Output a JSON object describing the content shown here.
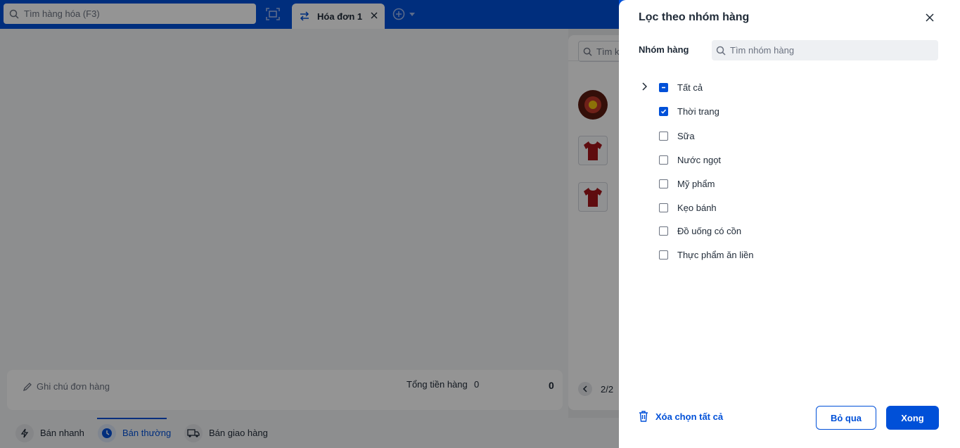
{
  "top": {
    "search_placeholder": "Tìm hàng hóa (F3)",
    "active_tab_label": "Hóa đơn 1"
  },
  "products_panel": {
    "search_placeholder": "Tìm k",
    "pager": "2/2"
  },
  "order_footer": {
    "note_placeholder": "Ghi chú đơn hàng",
    "total_label": "Tổng tiền hàng",
    "total_count": "0",
    "total_amount": "0"
  },
  "bottom_nav": {
    "items": [
      {
        "label": "Bán nhanh",
        "icon": "lightning-icon"
      },
      {
        "label": "Bán thường",
        "icon": "clock-icon",
        "active": true
      },
      {
        "label": "Bán giao hàng",
        "icon": "truck-icon"
      }
    ]
  },
  "filter_drawer": {
    "title": "Lọc theo nhóm hàng",
    "group_label": "Nhóm hàng",
    "group_search_placeholder": "Tìm nhóm hàng",
    "categories": [
      {
        "label": "Tất cả",
        "state": "partial"
      },
      {
        "label": "Thời trang",
        "state": "checked"
      },
      {
        "label": "Sữa",
        "state": "unchecked"
      },
      {
        "label": "Nước ngọt",
        "state": "unchecked"
      },
      {
        "label": "Mỹ phẩm",
        "state": "unchecked"
      },
      {
        "label": "Kẹo bánh",
        "state": "unchecked"
      },
      {
        "label": "Đồ uống có cồn",
        "state": "unchecked"
      },
      {
        "label": "Thực phẩm ăn liền",
        "state": "unchecked"
      }
    ],
    "clear_all_label": "Xóa chọn tất cả",
    "cancel_label": "Bỏ qua",
    "done_label": "Xong"
  },
  "colors": {
    "brand": "#0050d8",
    "overlay": "rgba(0,0,0,0.42)"
  }
}
